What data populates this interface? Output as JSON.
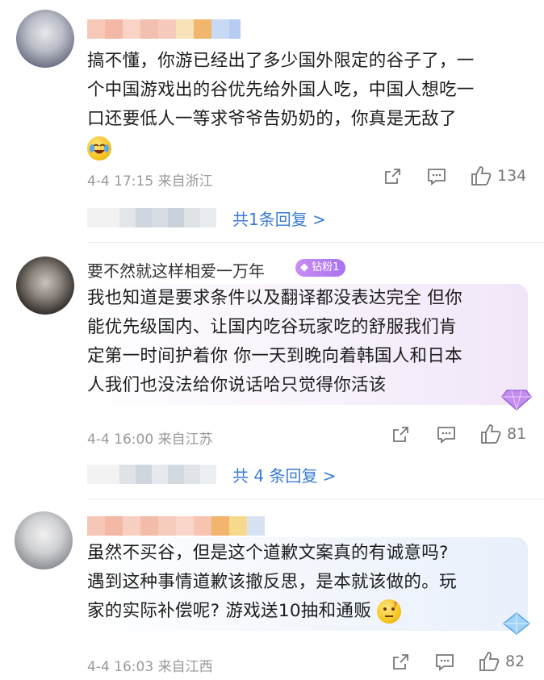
{
  "comments": [
    {
      "text_lines": [
        "搞不懂，你游已经出了多少国外限定的谷子了，一",
        "个中国游戏出的谷优先给外国人吃，中国人想吃一",
        "口还要低人一等求爷爷告奶奶的，你真是无敌了"
      ],
      "emoji": "laugh-cry-emoji",
      "meta": "4-4 17:15  来自浙江",
      "likes": "134",
      "replies_label": "共1条回复 >"
    },
    {
      "username": "要不然就这样相爱一万年",
      "badge": "钻粉1",
      "text_lines": [
        "我也知道是要求条件以及翻译都没表达完全 但你",
        "能优先级国内、让国内吃谷玩家吃的舒服我们肯",
        "定第一时间护着你 你一天到晚向着韩国人和日本",
        "人我们也没法给你说话哈只觉得你活该"
      ],
      "meta": "4-4 16:00  来自江苏",
      "likes": "81",
      "replies_label": "共 4 条回复 >"
    },
    {
      "text_lines": [
        "虽然不买谷，但是这个道歉文案真的有诚意吗?",
        "遇到这种事情道歉该撤反思，是本就该做的。玩",
        "家的实际补偿呢? 游戏送10抽和通贩"
      ],
      "emoji": "thinking-emoji",
      "meta": "4-4 16:03  来自江西",
      "likes": "82"
    }
  ],
  "colors": {
    "link": "#3a7bd5",
    "badge": "#a873f0",
    "meta": "#9a9a9a"
  }
}
